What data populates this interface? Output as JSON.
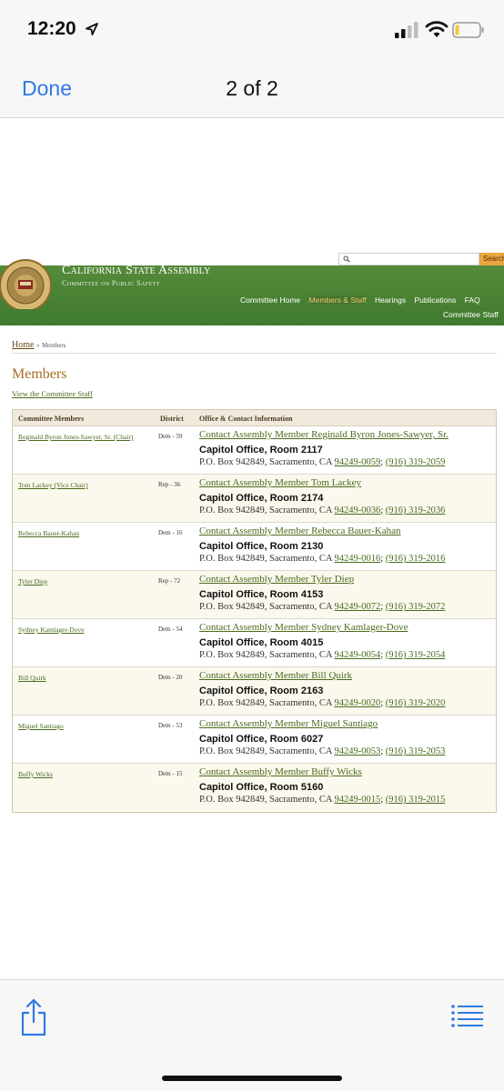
{
  "status_bar": {
    "time": "12:20"
  },
  "nav_bar": {
    "done_label": "Done",
    "title": "2 of 2"
  },
  "site": {
    "title": "California State Assembly",
    "subtitle": "Committee on Public Safety",
    "search_button": "Search",
    "nav": [
      "Committee Home",
      "Members & Staff",
      "Hearings",
      "Publications",
      "FAQ"
    ],
    "nav_second_row": "Committee Staff",
    "colors": {
      "header_green": "#4a8535",
      "link_green": "#4b6b1b",
      "heading_gold": "#a56d1f",
      "search_orange": "#e9a540"
    }
  },
  "breadcrumb": {
    "home": "Home",
    "separator": "»",
    "current": "Members"
  },
  "page": {
    "heading": "Members",
    "staff_link": "View the Committee Staff"
  },
  "table": {
    "headers": [
      "Committee Members",
      "District",
      "Office & Contact Information"
    ],
    "rows": [
      {
        "name": "Reginald Byron Jones-Sawyer, Sr. (Chair)",
        "district": "Dem - 59",
        "contact": "Contact Assembly Member Reginald Byron Jones-Sawyer, Sr.",
        "office": "Capitol Office, Room 2117",
        "address": "P.O. Box 942849, Sacramento, CA",
        "zip": "94249-0059",
        "sep": ";",
        "phone": "(916) 319-2059"
      },
      {
        "name": "Tom Lackey (Vice Chair)",
        "district": "Rep - 36",
        "contact": "Contact Assembly Member Tom Lackey",
        "office": "Capitol Office, Room 2174",
        "address": "P.O. Box 942849, Sacramento, CA",
        "zip": "94249-0036",
        "sep": ";",
        "phone": "(916) 319-2036"
      },
      {
        "name": "Rebecca Bauer-Kahan",
        "district": "Dem - 16",
        "contact": "Contact Assembly Member Rebecca Bauer-Kahan",
        "office": "Capitol Office, Room 2130",
        "address": "P.O. Box 942849, Sacramento, CA",
        "zip": "94249-0016",
        "sep": ";",
        "phone": "(916) 319-2016"
      },
      {
        "name": "Tyler Diep",
        "district": "Rep - 72",
        "contact": "Contact Assembly Member Tyler Diep",
        "office": "Capitol Office, Room 4153",
        "address": "P.O. Box 942849, Sacramento, CA",
        "zip": "94249-0072",
        "sep": ";",
        "phone": "(916) 319-2072"
      },
      {
        "name": "Sydney Kamlager-Dove",
        "district": "Dem - 54",
        "contact": "Contact Assembly Member Sydney Kamlager-Dove",
        "office": "Capitol Office, Room 4015",
        "address": "P.O. Box 942849, Sacramento, CA",
        "zip": "94249-0054",
        "sep": ";",
        "phone": "(916) 319-2054"
      },
      {
        "name": "Bill Quirk",
        "district": "Dem - 20",
        "contact": "Contact Assembly Member Bill Quirk",
        "office": "Capitol Office, Room 2163",
        "address": "P.O. Box 942849, Sacramento, CA",
        "zip": "94249-0020",
        "sep": ";",
        "phone": "(916) 319-2020"
      },
      {
        "name": "Miguel Santiago",
        "district": "Dem - 53",
        "contact": "Contact Assembly Member Miguel Santiago",
        "office": "Capitol Office, Room 6027",
        "address": "P.O. Box 942849, Sacramento, CA",
        "zip": "94249-0053",
        "sep": ";",
        "phone": "(916) 319-2053"
      },
      {
        "name": "Buffy Wicks",
        "district": "Dem - 15",
        "contact": "Contact Assembly Member Buffy Wicks",
        "office": "Capitol Office, Room 5160",
        "address": "P.O. Box 942849, Sacramento, CA",
        "zip": "94249-0015",
        "sep": ";",
        "phone": "(916) 319-2015"
      }
    ]
  },
  "bottom_toolbar": {
    "share_icon": "share-icon",
    "list_icon": "list-icon"
  }
}
